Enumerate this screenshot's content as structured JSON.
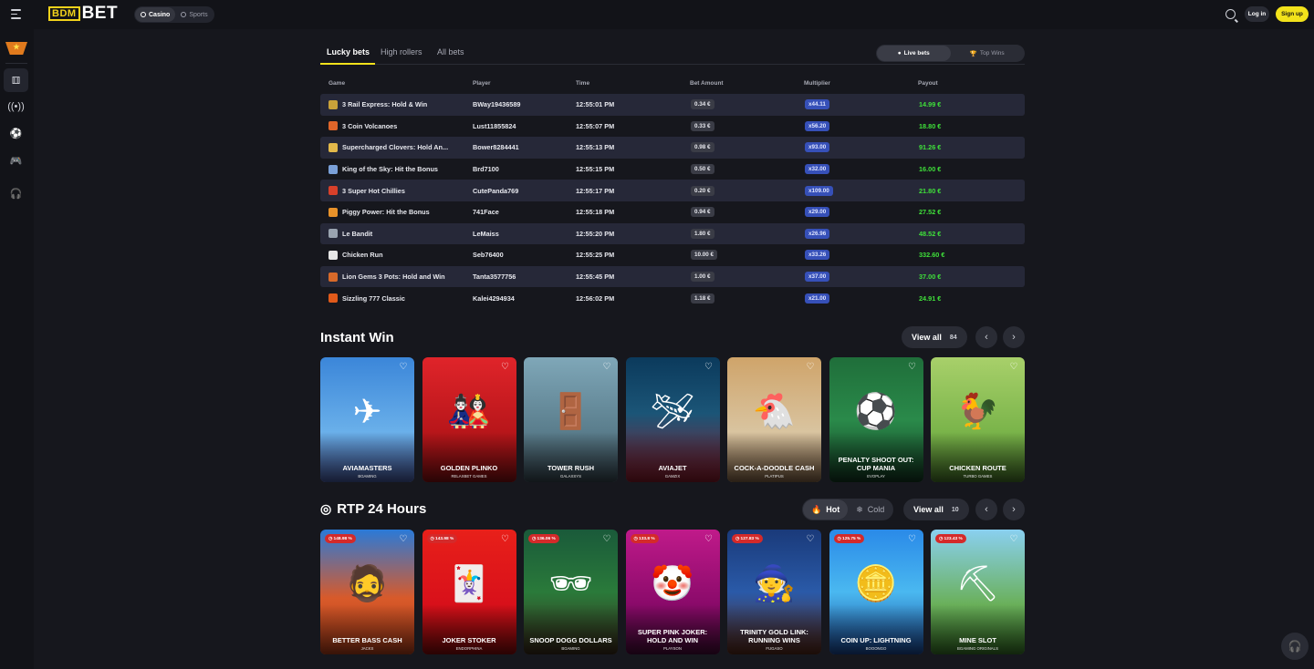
{
  "header": {
    "logo_box": "BDM",
    "logo_text": "BET",
    "modes": [
      {
        "label": "Casino"
      },
      {
        "label": "Sports"
      }
    ],
    "login_label": "Log in",
    "signup_label": "Sign up"
  },
  "bets": {
    "tabs": [
      {
        "label": "Lucky bets"
      },
      {
        "label": "High rollers"
      },
      {
        "label": "All bets"
      }
    ],
    "toggle": [
      {
        "label": "Live bets"
      },
      {
        "label": "Top Wins"
      }
    ],
    "columns": {
      "game": "Game",
      "player": "Player",
      "time": "Time",
      "amount": "Bet Amount",
      "multiplier": "Multiplier",
      "payout": "Payout"
    },
    "rows": [
      {
        "game": "3 Rail Express: Hold & Win",
        "player": "BWay19436589",
        "time": "12:55:01 PM",
        "amount": "0.34 €",
        "multiplier": "x44.11",
        "payout": "14.99 €",
        "icon_color": "#c9a23a"
      },
      {
        "game": "3 Coin Volcanoes",
        "player": "Lust11855824",
        "time": "12:55:07 PM",
        "amount": "0.33 €",
        "multiplier": "x56.20",
        "payout": "18.80 €",
        "icon_color": "#e0662a"
      },
      {
        "game": "Supercharged Clovers: Hold An...",
        "player": "Bower8284441",
        "time": "12:55:13 PM",
        "amount": "0.98 €",
        "multiplier": "x93.00",
        "payout": "91.26 €",
        "icon_color": "#e2b84a"
      },
      {
        "game": "King of the Sky: Hit the Bonus",
        "player": "Brd7100",
        "time": "12:55:15 PM",
        "amount": "0.50 €",
        "multiplier": "x32.00",
        "payout": "16.00 €",
        "icon_color": "#7aa0d8"
      },
      {
        "game": "3 Super Hot Chillies",
        "player": "CutePanda769",
        "time": "12:55:17 PM",
        "amount": "0.20 €",
        "multiplier": "x109.00",
        "payout": "21.80 €",
        "icon_color": "#d8402a"
      },
      {
        "game": "Piggy Power: Hit the Bonus",
        "player": "741Face",
        "time": "12:55:18 PM",
        "amount": "0.94 €",
        "multiplier": "x29.00",
        "payout": "27.52 €",
        "icon_color": "#e8922a"
      },
      {
        "game": "Le Bandit",
        "player": "LeMaiss",
        "time": "12:55:20 PM",
        "amount": "1.80 €",
        "multiplier": "x26.96",
        "payout": "48.52 €",
        "icon_color": "#9aa4b0"
      },
      {
        "game": "Chicken Run",
        "player": "Seb76400",
        "time": "12:55:25 PM",
        "amount": "10.00 €",
        "multiplier": "x33.26",
        "payout": "332.60 €",
        "icon_color": "#e6e6e6"
      },
      {
        "game": "Lion Gems 3 Pots: Hold and Win",
        "player": "Tanta3577756",
        "time": "12:55:45 PM",
        "amount": "1.00 €",
        "multiplier": "x37.00",
        "payout": "37.00 €",
        "icon_color": "#d86a2a"
      },
      {
        "game": "Sizzling 777 Classic",
        "player": "Kalei4294934",
        "time": "12:56:02 PM",
        "amount": "1.18 €",
        "multiplier": "x21.00",
        "payout": "24.91 €",
        "icon_color": "#e05a1a"
      }
    ]
  },
  "instant_win": {
    "title": "Instant Win",
    "view_all_label": "View all",
    "view_all_count": "84",
    "cards": [
      {
        "title": "AVIAMASTERS",
        "provider": "BGAMING",
        "bg": "linear-gradient(180deg,#3b86d9 0%,#6ab0ea 60%,#4a5fa8 100%)",
        "art": "✈"
      },
      {
        "title": "GOLDEN PLINKO",
        "provider": "RELAXBET GAMES",
        "bg": "linear-gradient(180deg,#e0242a 0%,#b8161a 60%,#8a0f12 100%)",
        "art": "🎎"
      },
      {
        "title": "TOWER RUSH",
        "provider": "GALAXSYS",
        "bg": "linear-gradient(180deg,#7fa7b8 0%,#5a7d8c 60%,#3a4b55 100%)",
        "art": "🚪"
      },
      {
        "title": "AVIAJET",
        "provider": "GAMZIX",
        "bg": "linear-gradient(180deg,#0b3a5c 0%,#1b5577 45%,#8a1a2a 100%)",
        "art": "🛩"
      },
      {
        "title": "COCK-A-DOODLE CASH",
        "provider": "PLATIPUS",
        "bg": "linear-gradient(180deg,#cfa46a 0%,#d9c4a0 60%,#8a6a4a 100%)",
        "art": "🐔"
      },
      {
        "title": "PENALTY SHOOT OUT: CUP MANIA",
        "provider": "EVOPLAY",
        "bg": "linear-gradient(180deg,#1f6e3a 0%,#2a8a4a 50%,#123a22 100%)",
        "art": "⚽"
      },
      {
        "title": "CHICKEN ROUTE",
        "provider": "TURBO GAMES",
        "bg": "linear-gradient(180deg,#a8d06a 0%,#7ab44a 60%,#4a7a2a 100%)",
        "art": "🐓"
      }
    ]
  },
  "rtp": {
    "title": "RTP 24 Hours",
    "hot_label": "Hot",
    "cold_label": "Cold",
    "view_all_label": "View all",
    "view_all_count": "10",
    "cards": [
      {
        "title": "BETTER BASS CASH",
        "provider": "JACKS",
        "badge": "148.98 %",
        "bg": "linear-gradient(180deg,#2a7ad8 0%,#d85a2a 55%,#b8401a 100%)",
        "art": "🧔"
      },
      {
        "title": "JOKER STOKER",
        "provider": "ENDORPHINA",
        "badge": "143.98 %",
        "bg": "linear-gradient(180deg,#e8201a 0%,#d8101a 60%,#8a0a0a 100%)",
        "art": "🃏"
      },
      {
        "title": "SNOOP DOGG DOLLARS",
        "provider": "BGAMING",
        "badge": "136.06 %",
        "bg": "linear-gradient(180deg,#1a5a3a 0%,#2a7a3a 50%,#3a2a1a 100%)",
        "art": "🕶"
      },
      {
        "title": "SUPER PINK JOKER: HOLD AND WIN",
        "provider": "PLAYSON",
        "badge": "133.8 %",
        "bg": "linear-gradient(180deg,#c01a8a 0%,#8a0a6a 60%,#4a0a3a 100%)",
        "art": "🤡"
      },
      {
        "title": "TRINITY GOLD LINK: RUNNING WINS",
        "provider": "FUGASO",
        "badge": "127.83 %",
        "bg": "linear-gradient(180deg,#1a3a7a 0%,#2a5aa8 50%,#5a2a1a 100%)",
        "art": "🧙"
      },
      {
        "title": "COIN UP: LIGHTNING",
        "provider": "BOOONGO",
        "badge": "125.75 %",
        "bg": "linear-gradient(180deg,#2a8ae8 0%,#4ab8f0 50%,#1a4a9a 100%)",
        "art": "🪙"
      },
      {
        "title": "MINE SLOT",
        "provider": "BGAMING ORIGINALS",
        "badge": "123.43 %",
        "bg": "linear-gradient(180deg,#8ad0f0 0%,#6ab05a 60%,#3a7a2a 100%)",
        "art": "⛏"
      }
    ]
  },
  "colors": {
    "accent": "#f2e21b",
    "payout": "#3fe03a",
    "multiplier": "#3650b8",
    "badge": "#d42a2a"
  },
  "icons": [
    "menu-icon",
    "search-icon",
    "casino-icon",
    "sports-icon",
    "heart-icon",
    "chevron-left-icon",
    "chevron-right-icon",
    "headset-icon",
    "flame-icon",
    "snowflake-icon"
  ]
}
